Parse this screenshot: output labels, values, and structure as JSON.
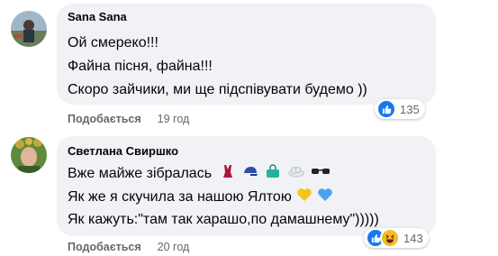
{
  "comments": [
    {
      "author": "Sana Sana",
      "lines": [
        "Ой смереко!!!",
        "Файна пісня, файна!!!",
        "Скоро зайчики, ми ще підспівувати будемо ))"
      ],
      "like_label": "Подобається",
      "time": "19 год",
      "reaction_count": "135",
      "reactions": [
        "like-icon"
      ]
    },
    {
      "author": "Светлана Свиршко",
      "lines": [
        "Вже майже зібралась",
        "Як же я скучила за нашою Ялтою",
        "Як кажуть:\"там так харашо,по дамашнему\")))))"
      ],
      "line_emojis": [
        [
          "swimsuit-emoji",
          "cap-emoji",
          "handbag-emoji",
          "cloud-emoji",
          "sunglasses-emoji"
        ],
        [
          "yellow-heart-emoji",
          "blue-heart-emoji"
        ],
        []
      ],
      "like_label": "Подобається",
      "time": "20 год",
      "reaction_count": "143",
      "reactions": [
        "like-icon",
        "laughing-icon"
      ]
    }
  ],
  "colors": {
    "bubble": "#f0f2f5",
    "text": "#050505",
    "meta": "#65676b",
    "like_blue": "#1877f2",
    "haha_yellow": "#f7b928"
  }
}
